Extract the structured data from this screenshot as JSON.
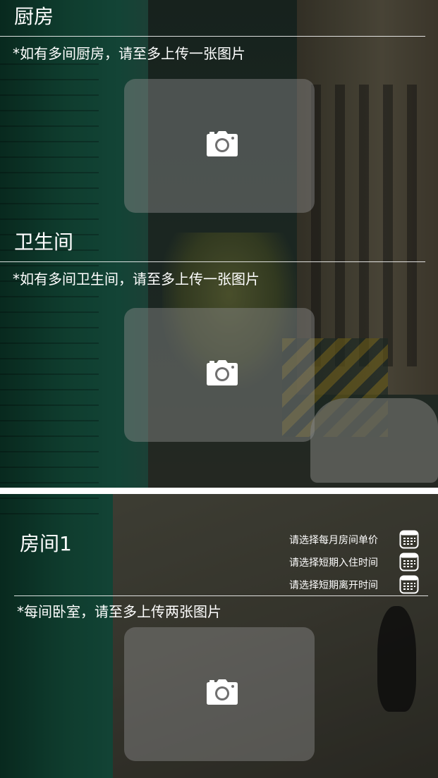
{
  "kitchen": {
    "title": "厨房",
    "note": "*如有多间厨房，请至多上传一张图片",
    "upload_icon": "camera-icon"
  },
  "bathroom": {
    "title": "卫生间",
    "note": "*如有多间卫生间，请至多上传一张图片",
    "upload_icon": "camera-icon"
  },
  "room": {
    "title": "房间1",
    "pickers": [
      {
        "label": "请选择每月房间单价",
        "icon": "calendar-icon"
      },
      {
        "label": "请选择短期入住时间",
        "icon": "calendar-icon"
      },
      {
        "label": "请选择短期离开时间",
        "icon": "calendar-icon"
      }
    ],
    "note": "*每间卧室，请至多上传两张图片",
    "upload_icon": "camera-icon"
  },
  "colors": {
    "text": "#ffffff",
    "upload_box": "#8c8c8c",
    "divider": "#ffffff"
  }
}
